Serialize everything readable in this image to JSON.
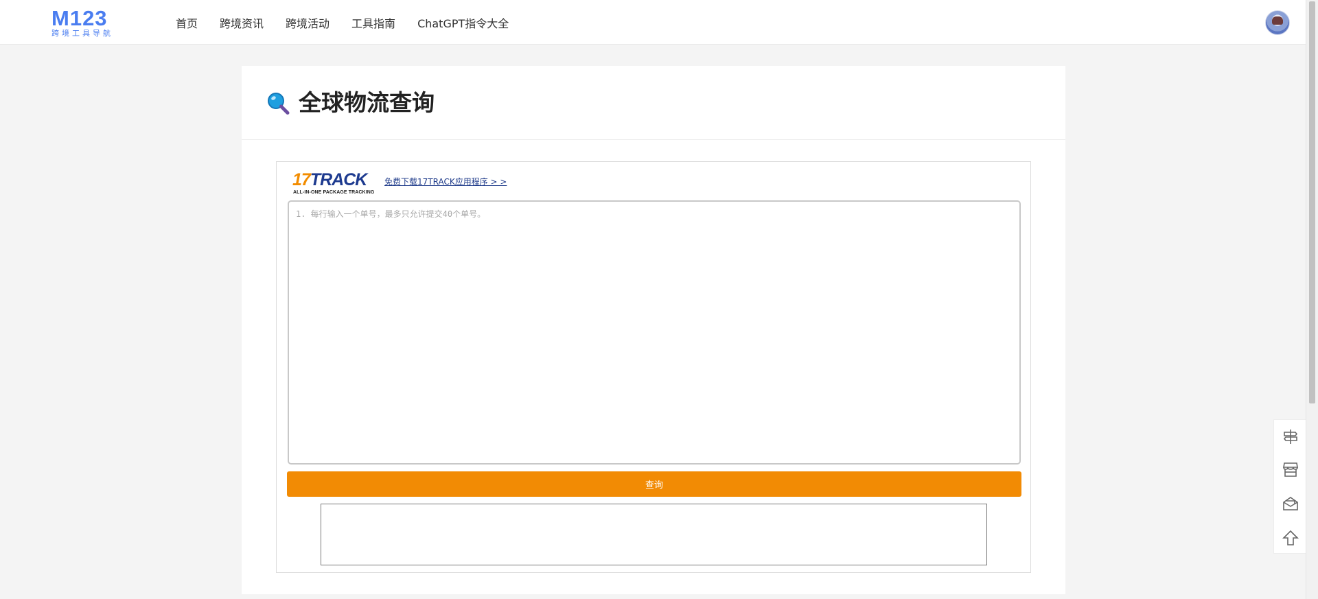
{
  "header": {
    "logo_mark": "M123",
    "logo_sub": "跨境工具导航",
    "nav": [
      {
        "label": "首页"
      },
      {
        "label": "跨境资讯"
      },
      {
        "label": "跨境活动"
      },
      {
        "label": "工具指南"
      },
      {
        "label": "ChatGPT指令大全"
      }
    ],
    "avatar_icon": "user-avatar"
  },
  "main": {
    "title": "全球物流查询",
    "title_icon": "magnifier-icon",
    "widget": {
      "brand_17": "17",
      "brand_track": "TRACK",
      "brand_sub": "ALL-IN-ONE PACKAGE TRACKING",
      "download_link": "免费下载17TRACK应用程序 > >",
      "input_placeholder": "1. 每行输入一个单号，最多只允许提交40个单号。",
      "query_button": "查询"
    }
  },
  "side_tools": [
    {
      "icon": "signpost-icon"
    },
    {
      "icon": "store-icon"
    },
    {
      "icon": "mail-open-icon"
    },
    {
      "icon": "arrow-up-icon"
    }
  ],
  "colors": {
    "accent": "#4a7df0",
    "button": "#f28b04",
    "brand_orange": "#f28c00",
    "brand_blue": "#1d3a8f"
  }
}
